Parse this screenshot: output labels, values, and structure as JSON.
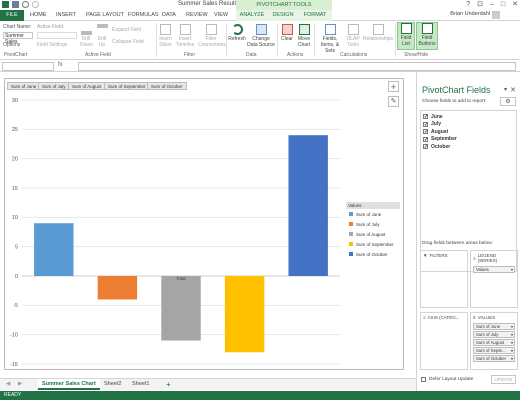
{
  "app": {
    "doc_title": "Summer Sales Results - Excel",
    "context_tab_group": "PIVOTCHART TOOLS",
    "user": "Brian Underdahl",
    "window_controls": [
      "?",
      "⊡",
      "–",
      "□",
      "✕"
    ]
  },
  "tabs": [
    "FILE",
    "HOME",
    "INSERT",
    "PAGE LAYOUT",
    "FORMULAS",
    "DATA",
    "REVIEW",
    "VIEW",
    "ANALYZE",
    "DESIGN",
    "FORMAT"
  ],
  "ribbon": {
    "chart_name_label": "Chart Name:",
    "chart_name_value": "Summer Sales",
    "options": "Options",
    "active_field_label": "Active Field:",
    "field_settings": "Field Settings",
    "drill_down": "Drill Down",
    "drill_up": "Drill Up",
    "expand_field": "Expand Field",
    "collapse_field": "Collapse Field",
    "insert_slicer": "Insert Slicer",
    "insert_timeline": "Insert Timeline",
    "filter_connections": "Filter Connections",
    "refresh": "Refresh",
    "change_data_source": "Change Data Source",
    "clear": "Clear",
    "move_chart": "Move Chart",
    "fields_items_sets": "Fields, Items, & Sets",
    "olap_tools": "OLAP Tools",
    "relationships": "Relationships",
    "field_list": "Field List",
    "field_buttons": "Field Buttons",
    "groups": {
      "pivotchart": "PivotChart",
      "active_field": "Active Field",
      "filter": "Filter",
      "data": "Data",
      "actions": "Actions",
      "calculations": "Calculations",
      "show_hide": "Show/Hide"
    }
  },
  "formula_bar": {
    "fx": "fx",
    "name_box": "",
    "value": ""
  },
  "chart": {
    "field_buttons": [
      "Sum of June",
      "Sum of July",
      "Sum of August",
      "Sum of September",
      "Sum of October"
    ],
    "legend_title": "Values",
    "tooltip": "Total",
    "side_buttons": {
      "add": "+",
      "style": "✎"
    }
  },
  "chart_data": {
    "type": "bar",
    "categories": [
      "Total"
    ],
    "series": [
      {
        "name": "Sum of June",
        "values": [
          9
        ],
        "color": "#5b9bd5"
      },
      {
        "name": "Sum of July",
        "values": [
          -4
        ],
        "color": "#ed7d31"
      },
      {
        "name": "Sum of August",
        "values": [
          -11
        ],
        "color": "#a5a5a5"
      },
      {
        "name": "Sum of September",
        "values": [
          -13
        ],
        "color": "#ffc000"
      },
      {
        "name": "Sum of October",
        "values": [
          24
        ],
        "color": "#4472c4"
      }
    ],
    "yticks": [
      -15,
      -10,
      -5,
      0,
      5,
      10,
      15,
      20,
      25,
      30
    ],
    "ylim": [
      -15,
      30
    ],
    "grid": true,
    "legend_position": "right",
    "xlabel": "",
    "ylabel": "",
    "title": ""
  },
  "sheets": {
    "tabs": [
      "Summer Sales Chart",
      "Sheet2",
      "Sheet1"
    ],
    "active": "Summer Sales Chart",
    "add": "+"
  },
  "status": {
    "ready": "READY"
  },
  "pane": {
    "title": "PivotChart Fields",
    "subtitle": "Choose fields to add to report:",
    "fields": [
      {
        "name": "June",
        "checked": true
      },
      {
        "name": "July",
        "checked": true
      },
      {
        "name": "August",
        "checked": true
      },
      {
        "name": "September",
        "checked": true
      },
      {
        "name": "October",
        "checked": true
      }
    ],
    "drag_hint": "Drag fields between areas below:",
    "areas": {
      "filters": "FILTERS",
      "legend": "LEGEND (SERIES)",
      "axis": "AXIS (CATEG...",
      "values": "VALUES"
    },
    "legend_items": [
      "Values"
    ],
    "values_items": [
      "Sum of June",
      "Sum of July",
      "Sum of August",
      "Sum of Septe...",
      "Sum of October"
    ],
    "defer": "Defer Layout Update",
    "update": "UPDATE"
  }
}
